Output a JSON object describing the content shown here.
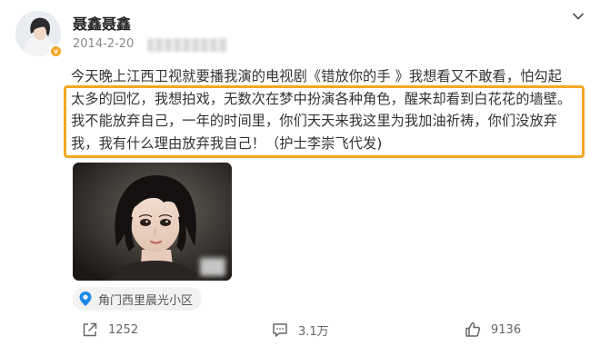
{
  "post": {
    "author": "聂鑫聂鑫",
    "date": "2014-2-20",
    "verified_badge": "v",
    "text_lines": [
      "今天晚上江西卫视就要播我演的电视剧《错放你的手 》我想看又不敢看，怕勾起",
      "太多的回忆，我想拍戏，无数次在梦中扮演各种角色，醒来却看到白花花的墙壁。",
      "我不能放弃自己，一年的时间里，你们天天来我这里为我加油祈祷，你们没放弃",
      "我，我有什么理由放弃我自己！（护士李崇飞代发)"
    ],
    "highlight_color": "#f5a623",
    "location": "角门西里晨光小区",
    "location_icon": "location-pin-icon"
  },
  "actions": {
    "share_count": "1252",
    "comment_count": "3.1万",
    "like_count": "9136"
  },
  "icons": {
    "menu": "chevron-down-icon",
    "share": "share-icon",
    "comment": "comment-icon",
    "like": "thumbs-up-icon"
  },
  "colors": {
    "accent": "#f5a623",
    "location_pin": "#1e88e5"
  }
}
